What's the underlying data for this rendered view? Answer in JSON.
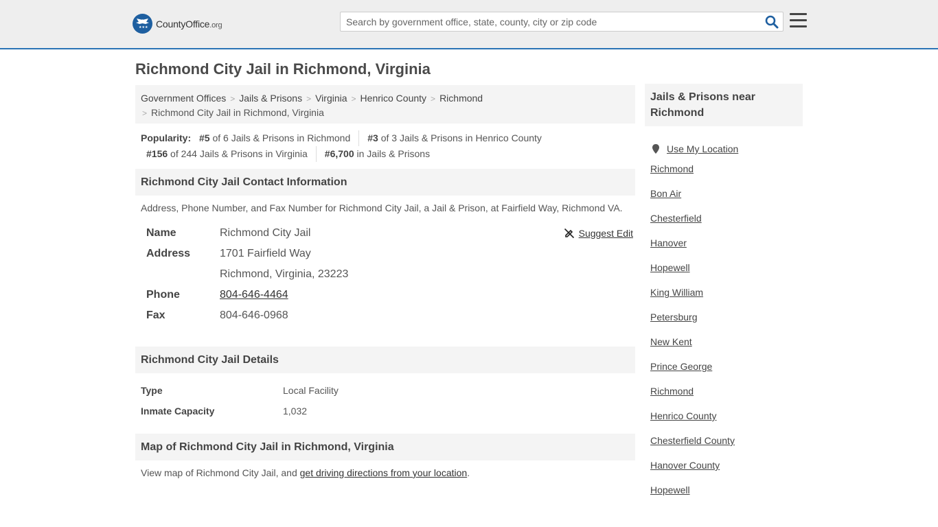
{
  "header": {
    "logo_brand": "CountyOffice",
    "logo_tld": ".org",
    "search_placeholder": "Search by government office, state, county, city or zip code"
  },
  "page_title": "Richmond City Jail in Richmond, Virginia",
  "breadcrumb": {
    "items": [
      "Government Offices",
      "Jails & Prisons",
      "Virginia",
      "Henrico County",
      "Richmond"
    ],
    "current": "Richmond City Jail in Richmond, Virginia"
  },
  "popularity": {
    "label": "Popularity:",
    "items": [
      {
        "rank": "#5",
        "text": "of 6 Jails & Prisons in Richmond"
      },
      {
        "rank": "#3",
        "text": "of 3 Jails & Prisons in Henrico County"
      },
      {
        "rank": "#156",
        "text": "of 244 Jails & Prisons in Virginia"
      },
      {
        "rank": "#6,700",
        "text": "in Jails & Prisons"
      }
    ]
  },
  "contact": {
    "heading": "Richmond City Jail Contact Information",
    "description": "Address, Phone Number, and Fax Number for Richmond City Jail, a Jail & Prison, at Fairfield Way, Richmond VA.",
    "suggest_edit": "Suggest Edit",
    "name_label": "Name",
    "name": "Richmond City Jail",
    "address_label": "Address",
    "address_line1": "1701 Fairfield Way",
    "address_line2": "Richmond, Virginia, 23223",
    "phone_label": "Phone",
    "phone": "804-646-4464",
    "fax_label": "Fax",
    "fax": "804-646-0968"
  },
  "details": {
    "heading": "Richmond City Jail Details",
    "rows": [
      {
        "label": "Type",
        "value": "Local Facility"
      },
      {
        "label": "Inmate Capacity",
        "value": "1,032"
      }
    ]
  },
  "map": {
    "heading": "Map of Richmond City Jail in Richmond, Virginia",
    "text_before": "View map of Richmond City Jail, and ",
    "link": "get driving directions from your location",
    "text_after": "."
  },
  "sidebar": {
    "heading": "Jails & Prisons near Richmond",
    "use_location": "Use My Location",
    "links": [
      "Richmond",
      "Bon Air",
      "Chesterfield",
      "Hanover",
      "Hopewell",
      "King William",
      "Petersburg",
      "New Kent",
      "Prince George",
      "Richmond",
      "Henrico County",
      "Chesterfield County",
      "Hanover County",
      "Hopewell"
    ]
  },
  "colors": {
    "accent": "#2a73b5",
    "logo_blue": "#1e5fa0",
    "panel_bg": "#f4f4f4",
    "header_bg": "#eeeeee"
  }
}
